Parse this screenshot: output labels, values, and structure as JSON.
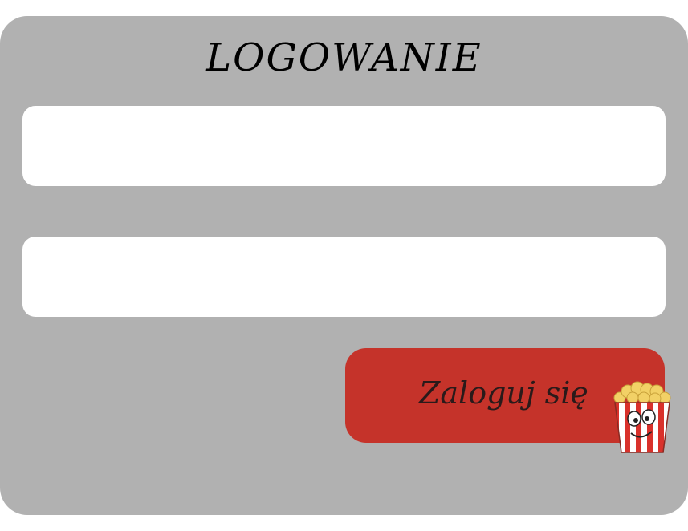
{
  "form": {
    "title": "LOGOWANIE",
    "login_field": {
      "value": "",
      "placeholder": ""
    },
    "password_field": {
      "value": "",
      "placeholder": ""
    },
    "submit_label": "Zaloguj się"
  },
  "icons": {
    "submit_mascot": "popcorn-icon"
  },
  "colors": {
    "panel": "#b1b1b1",
    "field": "#ffffff",
    "button": "#c5332a",
    "popcorn_stripe": "#d9312b",
    "popcorn_kernel": "#f2d166"
  }
}
